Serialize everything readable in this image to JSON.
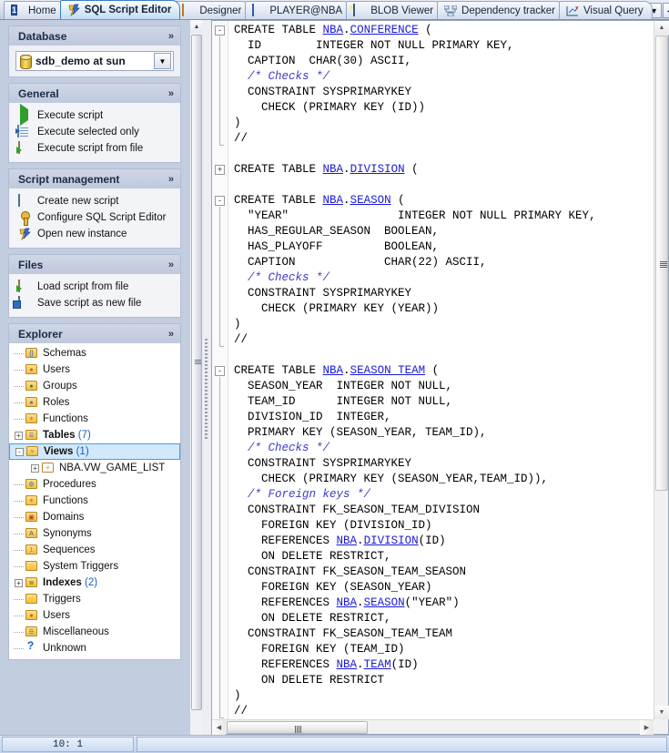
{
  "tabs": [
    {
      "label": "Home",
      "icon": "home-number-icon",
      "active": false
    },
    {
      "label": "SQL Script Editor",
      "icon": "lightning-bolt-icon",
      "active": true
    },
    {
      "label": "Designer",
      "icon": "designer-grid-icon",
      "active": false
    },
    {
      "label": "PLAYER@NBA",
      "icon": "table-data-icon",
      "active": false
    },
    {
      "label": "BLOB Viewer",
      "icon": "image-icon",
      "active": false
    },
    {
      "label": "Dependency tracker",
      "icon": "dependency-nodes-icon",
      "active": false
    },
    {
      "label": "Visual Query",
      "icon": "visual-query-icon",
      "active": false
    }
  ],
  "tab_controls": {
    "dropdown": "▼",
    "prev": "◄",
    "next": "►",
    "close": "✕"
  },
  "sidebar": {
    "groups": [
      {
        "title": "Database",
        "collapse_icon": "»",
        "type": "combo",
        "combo": {
          "icon": "database-cylinder-icon",
          "value": "sdb_demo at sun",
          "arrow": "▼"
        }
      },
      {
        "title": "General",
        "collapse_icon": "»",
        "type": "actions",
        "items": [
          {
            "label": "Execute script",
            "icon": "play-icon"
          },
          {
            "label": "Execute selected only",
            "icon": "execute-selection-icon"
          },
          {
            "label": "Execute script from file",
            "icon": "execute-file-icon"
          }
        ]
      },
      {
        "title": "Script management",
        "collapse_icon": "»",
        "type": "actions",
        "items": [
          {
            "label": "Create new script",
            "icon": "new-document-icon"
          },
          {
            "label": "Configure SQL Script Editor",
            "icon": "wrench-key-icon"
          },
          {
            "label": "Open new instance",
            "icon": "lightning-bolt-icon"
          }
        ]
      },
      {
        "title": "Files",
        "collapse_icon": "»",
        "type": "actions",
        "items": [
          {
            "label": "Load script from file",
            "icon": "open-folder-icon"
          },
          {
            "label": "Save script as new file",
            "icon": "save-disk-icon"
          }
        ]
      }
    ],
    "explorer": {
      "title": "Explorer",
      "collapse_icon": "»",
      "nodes": [
        {
          "label": "Schemas",
          "count": "",
          "icon": "schema-folder-icon",
          "expander": "",
          "bold": false,
          "selected": false,
          "child": false
        },
        {
          "label": "Users",
          "count": "",
          "icon": "users-folder-icon",
          "expander": "",
          "bold": false,
          "selected": false,
          "child": false
        },
        {
          "label": "Groups",
          "count": "",
          "icon": "groups-folder-icon",
          "expander": "",
          "bold": false,
          "selected": false,
          "child": false
        },
        {
          "label": "Roles",
          "count": "",
          "icon": "roles-folder-icon",
          "expander": "",
          "bold": false,
          "selected": false,
          "child": false
        },
        {
          "label": "Functions",
          "count": "",
          "icon": "functions-folder-icon",
          "expander": "",
          "bold": false,
          "selected": false,
          "child": false
        },
        {
          "label": "Tables",
          "count": "(7)",
          "icon": "tables-folder-icon",
          "expander": "+",
          "bold": true,
          "selected": false,
          "child": false
        },
        {
          "label": "Views",
          "count": "(1)",
          "icon": "views-folder-icon",
          "expander": "-",
          "bold": true,
          "selected": true,
          "child": false
        },
        {
          "label": "NBA.VW_GAME_LIST",
          "count": "",
          "icon": "view-item-icon",
          "expander": "+",
          "bold": false,
          "selected": false,
          "child": true
        },
        {
          "label": "Procedures",
          "count": "",
          "icon": "procedures-folder-icon",
          "expander": "",
          "bold": false,
          "selected": false,
          "child": false
        },
        {
          "label": "Functions",
          "count": "",
          "icon": "functions-folder-icon",
          "expander": "",
          "bold": false,
          "selected": false,
          "child": false
        },
        {
          "label": "Domains",
          "count": "",
          "icon": "domains-folder-icon",
          "expander": "",
          "bold": false,
          "selected": false,
          "child": false
        },
        {
          "label": "Synonyms",
          "count": "",
          "icon": "synonyms-folder-icon",
          "expander": "",
          "bold": false,
          "selected": false,
          "child": false
        },
        {
          "label": "Sequences",
          "count": "",
          "icon": "sequences-folder-icon",
          "expander": "",
          "bold": false,
          "selected": false,
          "child": false
        },
        {
          "label": "System Triggers",
          "count": "",
          "icon": "system-triggers-folder-icon",
          "expander": "",
          "bold": false,
          "selected": false,
          "child": false
        },
        {
          "label": "Indexes",
          "count": "(2)",
          "icon": "indexes-folder-icon",
          "expander": "+",
          "bold": true,
          "selected": false,
          "child": false
        },
        {
          "label": "Triggers",
          "count": "",
          "icon": "triggers-folder-icon",
          "expander": "",
          "bold": false,
          "selected": false,
          "child": false
        },
        {
          "label": "Users",
          "count": "",
          "icon": "users-folder-icon",
          "expander": "",
          "bold": false,
          "selected": false,
          "child": false
        },
        {
          "label": "Miscellaneous",
          "count": "",
          "icon": "miscellaneous-folder-icon",
          "expander": "",
          "bold": false,
          "selected": false,
          "child": false
        },
        {
          "label": "Unknown",
          "count": "",
          "icon": "question-mark-icon",
          "expander": "",
          "bold": false,
          "selected": false,
          "child": false
        }
      ]
    }
  },
  "editor": {
    "lines": [
      [
        {
          "t": "CREATE TABLE ",
          "c": "kw"
        },
        {
          "t": "NBA",
          "c": "lnk"
        },
        {
          "t": ".",
          "c": "kw"
        },
        {
          "t": "CONFERENCE",
          "c": "lnk"
        },
        {
          "t": " (",
          "c": "kw"
        }
      ],
      [
        {
          "t": "  ID        INTEGER NOT NULL PRIMARY KEY,",
          "c": "kw"
        }
      ],
      [
        {
          "t": "  CAPTION  CHAR(30) ASCII,",
          "c": "kw"
        }
      ],
      [
        {
          "t": "  /* Checks */",
          "c": "cmt"
        }
      ],
      [
        {
          "t": "  CONSTRAINT SYSPRIMARYKEY",
          "c": "kw"
        }
      ],
      [
        {
          "t": "    CHECK (PRIMARY KEY (ID))",
          "c": "kw"
        }
      ],
      [
        {
          "t": ")",
          "c": "kw"
        }
      ],
      [
        {
          "t": "//",
          "c": "kw"
        }
      ],
      [
        {
          "t": "",
          "c": "kw"
        }
      ],
      [
        {
          "t": "CREATE TABLE ",
          "c": "kw"
        },
        {
          "t": "NBA",
          "c": "lnk"
        },
        {
          "t": ".",
          "c": "kw"
        },
        {
          "t": "DIVISION",
          "c": "lnk"
        },
        {
          "t": " (",
          "c": "kw"
        }
      ],
      [
        {
          "t": "",
          "c": "kw"
        }
      ],
      [
        {
          "t": "CREATE TABLE ",
          "c": "kw"
        },
        {
          "t": "NBA",
          "c": "lnk"
        },
        {
          "t": ".",
          "c": "kw"
        },
        {
          "t": "SEASON",
          "c": "lnk"
        },
        {
          "t": " (",
          "c": "kw"
        }
      ],
      [
        {
          "t": "  \"YEAR\"                INTEGER NOT NULL PRIMARY KEY,",
          "c": "kw"
        }
      ],
      [
        {
          "t": "  HAS_REGULAR_SEASON  BOOLEAN,",
          "c": "kw"
        }
      ],
      [
        {
          "t": "  HAS_PLAYOFF         BOOLEAN,",
          "c": "kw"
        }
      ],
      [
        {
          "t": "  CAPTION             CHAR(22) ASCII,",
          "c": "kw"
        }
      ],
      [
        {
          "t": "  /* Checks */",
          "c": "cmt"
        }
      ],
      [
        {
          "t": "  CONSTRAINT SYSPRIMARYKEY",
          "c": "kw"
        }
      ],
      [
        {
          "t": "    CHECK (PRIMARY KEY (YEAR))",
          "c": "kw"
        }
      ],
      [
        {
          "t": ")",
          "c": "kw"
        }
      ],
      [
        {
          "t": "//",
          "c": "kw"
        }
      ],
      [
        {
          "t": "",
          "c": "kw"
        }
      ],
      [
        {
          "t": "CREATE TABLE ",
          "c": "kw"
        },
        {
          "t": "NBA",
          "c": "lnk"
        },
        {
          "t": ".",
          "c": "kw"
        },
        {
          "t": "SEASON_TEAM",
          "c": "lnk"
        },
        {
          "t": " (",
          "c": "kw"
        }
      ],
      [
        {
          "t": "  SEASON_YEAR  INTEGER NOT NULL,",
          "c": "kw"
        }
      ],
      [
        {
          "t": "  TEAM_ID      INTEGER NOT NULL,",
          "c": "kw"
        }
      ],
      [
        {
          "t": "  DIVISION_ID  INTEGER,",
          "c": "kw"
        }
      ],
      [
        {
          "t": "  PRIMARY KEY (SEASON_YEAR, TEAM_ID),",
          "c": "kw"
        }
      ],
      [
        {
          "t": "  /* Checks */",
          "c": "cmt"
        }
      ],
      [
        {
          "t": "  CONSTRAINT SYSPRIMARYKEY",
          "c": "kw"
        }
      ],
      [
        {
          "t": "    CHECK (PRIMARY KEY (SEASON_YEAR,TEAM_ID)),",
          "c": "kw"
        }
      ],
      [
        {
          "t": "  /* Foreign keys */",
          "c": "cmt"
        }
      ],
      [
        {
          "t": "  CONSTRAINT FK_SEASON_TEAM_DIVISION",
          "c": "kw"
        }
      ],
      [
        {
          "t": "    FOREIGN KEY (DIVISION_ID)",
          "c": "kw"
        }
      ],
      [
        {
          "t": "    REFERENCES ",
          "c": "kw"
        },
        {
          "t": "NBA",
          "c": "lnk"
        },
        {
          "t": ".",
          "c": "kw"
        },
        {
          "t": "DIVISION",
          "c": "lnk"
        },
        {
          "t": "(ID)",
          "c": "kw"
        }
      ],
      [
        {
          "t": "    ON DELETE RESTRICT,",
          "c": "kw"
        }
      ],
      [
        {
          "t": "  CONSTRAINT FK_SEASON_TEAM_SEASON",
          "c": "kw"
        }
      ],
      [
        {
          "t": "    FOREIGN KEY (SEASON_YEAR)",
          "c": "kw"
        }
      ],
      [
        {
          "t": "    REFERENCES ",
          "c": "kw"
        },
        {
          "t": "NBA",
          "c": "lnk"
        },
        {
          "t": ".",
          "c": "kw"
        },
        {
          "t": "SEASON",
          "c": "lnk"
        },
        {
          "t": "(\"YEAR\")",
          "c": "kw"
        }
      ],
      [
        {
          "t": "    ON DELETE RESTRICT,",
          "c": "kw"
        }
      ],
      [
        {
          "t": "  CONSTRAINT FK_SEASON_TEAM_TEAM",
          "c": "kw"
        }
      ],
      [
        {
          "t": "    FOREIGN KEY (TEAM_ID)",
          "c": "kw"
        }
      ],
      [
        {
          "t": "    REFERENCES ",
          "c": "kw"
        },
        {
          "t": "NBA",
          "c": "lnk"
        },
        {
          "t": ".",
          "c": "kw"
        },
        {
          "t": "TEAM",
          "c": "lnk"
        },
        {
          "t": "(ID)",
          "c": "kw"
        }
      ],
      [
        {
          "t": "    ON DELETE RESTRICT",
          "c": "kw"
        }
      ],
      [
        {
          "t": ")",
          "c": "kw"
        }
      ],
      [
        {
          "t": "//",
          "c": "kw"
        }
      ]
    ],
    "fold_markers": [
      {
        "line": 0,
        "state": "-"
      },
      {
        "line": 9,
        "state": "+"
      },
      {
        "line": 11,
        "state": "-"
      },
      {
        "line": 22,
        "state": "-"
      }
    ]
  },
  "status": {
    "position": "10:    1",
    "message": ""
  }
}
